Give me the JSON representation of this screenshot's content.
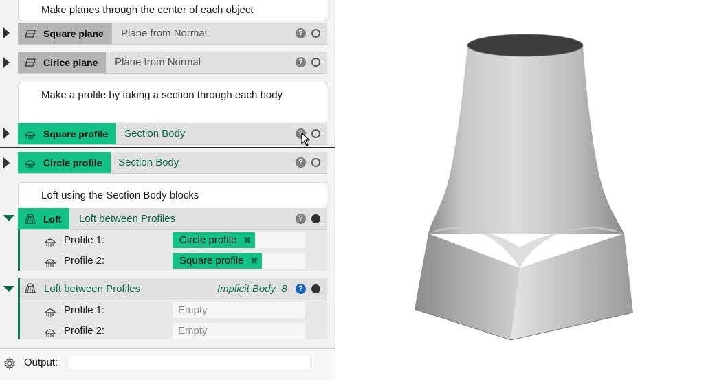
{
  "comments": [
    {
      "text": "Make planes through the center of each object"
    },
    {
      "text": "Make a profile by taking a section through each body"
    },
    {
      "text": "Loft using the Section Body blocks"
    }
  ],
  "blocks": {
    "square_plane": {
      "type_label": "Square plane",
      "op_label": "Plane from Normal",
      "type_icon": "plane-icon"
    },
    "circle_plane": {
      "type_label": "Cirlce plane",
      "op_label": "Plane from Normal",
      "type_icon": "plane-icon"
    },
    "square_profile": {
      "type_label": "Square profile",
      "op_label": "Section Body",
      "type_icon": "section-icon"
    },
    "circle_profile": {
      "type_label": "Circle profile",
      "op_label": "Section Body",
      "type_icon": "section-icon"
    },
    "loft": {
      "type_label": "Loft",
      "op_label": "Loft between Profiles",
      "type_icon": "loft-icon",
      "params": [
        {
          "label": "Profile 1:",
          "value": "Circle profile"
        },
        {
          "label": "Profile 2:",
          "value": "Square profile"
        }
      ]
    },
    "loft_implicit": {
      "op_label": "Loft between Profiles",
      "output_label": "Implicit Body_8",
      "type_icon": "loft-icon",
      "params": [
        {
          "label": "Profile 1:",
          "placeholder": "Empty"
        },
        {
          "label": "Profile 2:",
          "placeholder": "Empty"
        }
      ]
    }
  },
  "icons": {
    "help": "?",
    "remove": "✖"
  },
  "output_bar": {
    "label": "Output:",
    "value": "",
    "icon": "gear-icon"
  },
  "colors": {
    "accent_green": "#12c185",
    "dark_green": "#0b6b47",
    "chip_grey": "#b4b4b4",
    "help_blue": "#1565c0"
  },
  "viewport": {
    "object": "lofted solid from square base to circular top"
  }
}
